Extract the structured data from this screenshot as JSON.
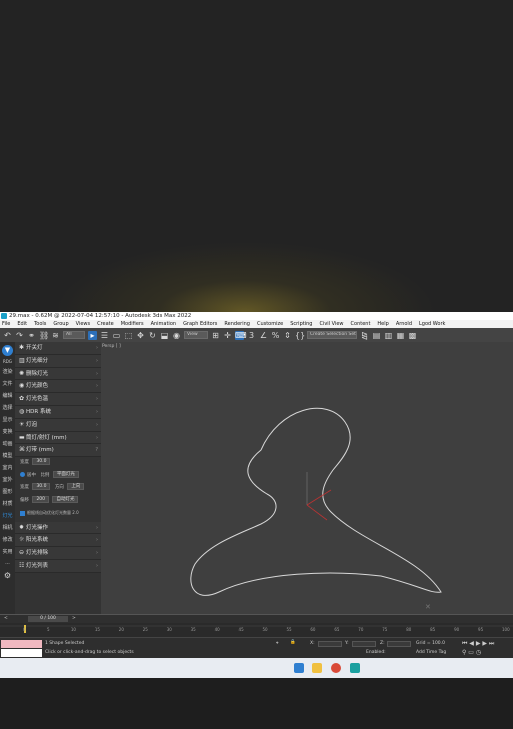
{
  "window": {
    "title": "29.max - 0.62M @ 2022-07-04 12:57:10 - Autodesk 3ds Max 2022"
  },
  "menu": {
    "items": [
      "File",
      "Edit",
      "Tools",
      "Group",
      "Views",
      "Create",
      "Modifiers",
      "Animation",
      "Graph Editors",
      "Rendering",
      "Customize",
      "Scripting",
      "Civil View",
      "Content",
      "Help",
      "Arnold",
      "Lgod Work"
    ]
  },
  "toolbar": {
    "filter_value": "All",
    "view_value": "View",
    "selection_set": "Create Selection Set"
  },
  "left_strip": {
    "items": [
      "RDG",
      "渲染",
      "文件",
      "编辑",
      "选择",
      "显示",
      "变换",
      "动画",
      "模型",
      "室内",
      "室外",
      "图形",
      "材质",
      "灯光",
      "相机",
      "修改",
      "实用",
      "···"
    ]
  },
  "panel": {
    "rows": [
      {
        "icon": "power-icon",
        "label": "开关灯"
      },
      {
        "icon": "lamp-icon",
        "label": "灯光细分"
      },
      {
        "icon": "bulb-icon",
        "label": "删除灯光"
      },
      {
        "icon": "color-icon",
        "label": "灯光颜色"
      },
      {
        "icon": "palette-icon",
        "label": "灯光色温"
      },
      {
        "icon": "hdr-icon",
        "label": "HDR 系统"
      },
      {
        "icon": "bulb-icon",
        "label": "灯泡"
      },
      {
        "icon": "strip-icon",
        "label": "筒灯/射灯 (mm)"
      },
      {
        "icon": "strip-icon",
        "label": "灯带 (mm)"
      }
    ],
    "settings": {
      "width_label": "宽度",
      "width_value": "30.0",
      "align_label": "居中",
      "proportion_label": "比例",
      "plane_light": "平面灯光",
      "width2_label": "宽度",
      "width2_value": "30.0",
      "direction_label": "方向",
      "direction_value": "上向",
      "height_label": "偏移",
      "height_value": "200",
      "auto_light": "自动灯光",
      "checkbox_label": "根据线自动优化灯光数量",
      "checkbox_value": "2.0"
    },
    "rows2": [
      {
        "icon": "bolt-icon",
        "label": "灯光操作"
      },
      {
        "icon": "sun-icon",
        "label": "阳光系统"
      },
      {
        "icon": "minus-icon",
        "label": "灯光排除"
      },
      {
        "icon": "list-icon",
        "label": "灯光列表"
      }
    ]
  },
  "viewport": {
    "label": "Persp [ ]"
  },
  "timeline": {
    "frame_display": "0 / 100",
    "ticks": [
      "0",
      "5",
      "10",
      "15",
      "20",
      "25",
      "30",
      "35",
      "40",
      "45",
      "50",
      "55",
      "60",
      "65",
      "70",
      "75",
      "80",
      "85",
      "90",
      "95",
      "100"
    ]
  },
  "status": {
    "selection": "1 Shape Selected",
    "hint": "Click or click-and-drag to select objects",
    "x_label": "X:",
    "y_label": "Y:",
    "z_label": "Z:",
    "grid": "Grid = 100.0",
    "enabled": "Enabled:",
    "add_time_tag": "Add Time Tag"
  },
  "colors": {
    "accent_blue": "#2f7fd0",
    "spline": "#d8d8d8",
    "pink_bar": "#f0b8c0"
  }
}
